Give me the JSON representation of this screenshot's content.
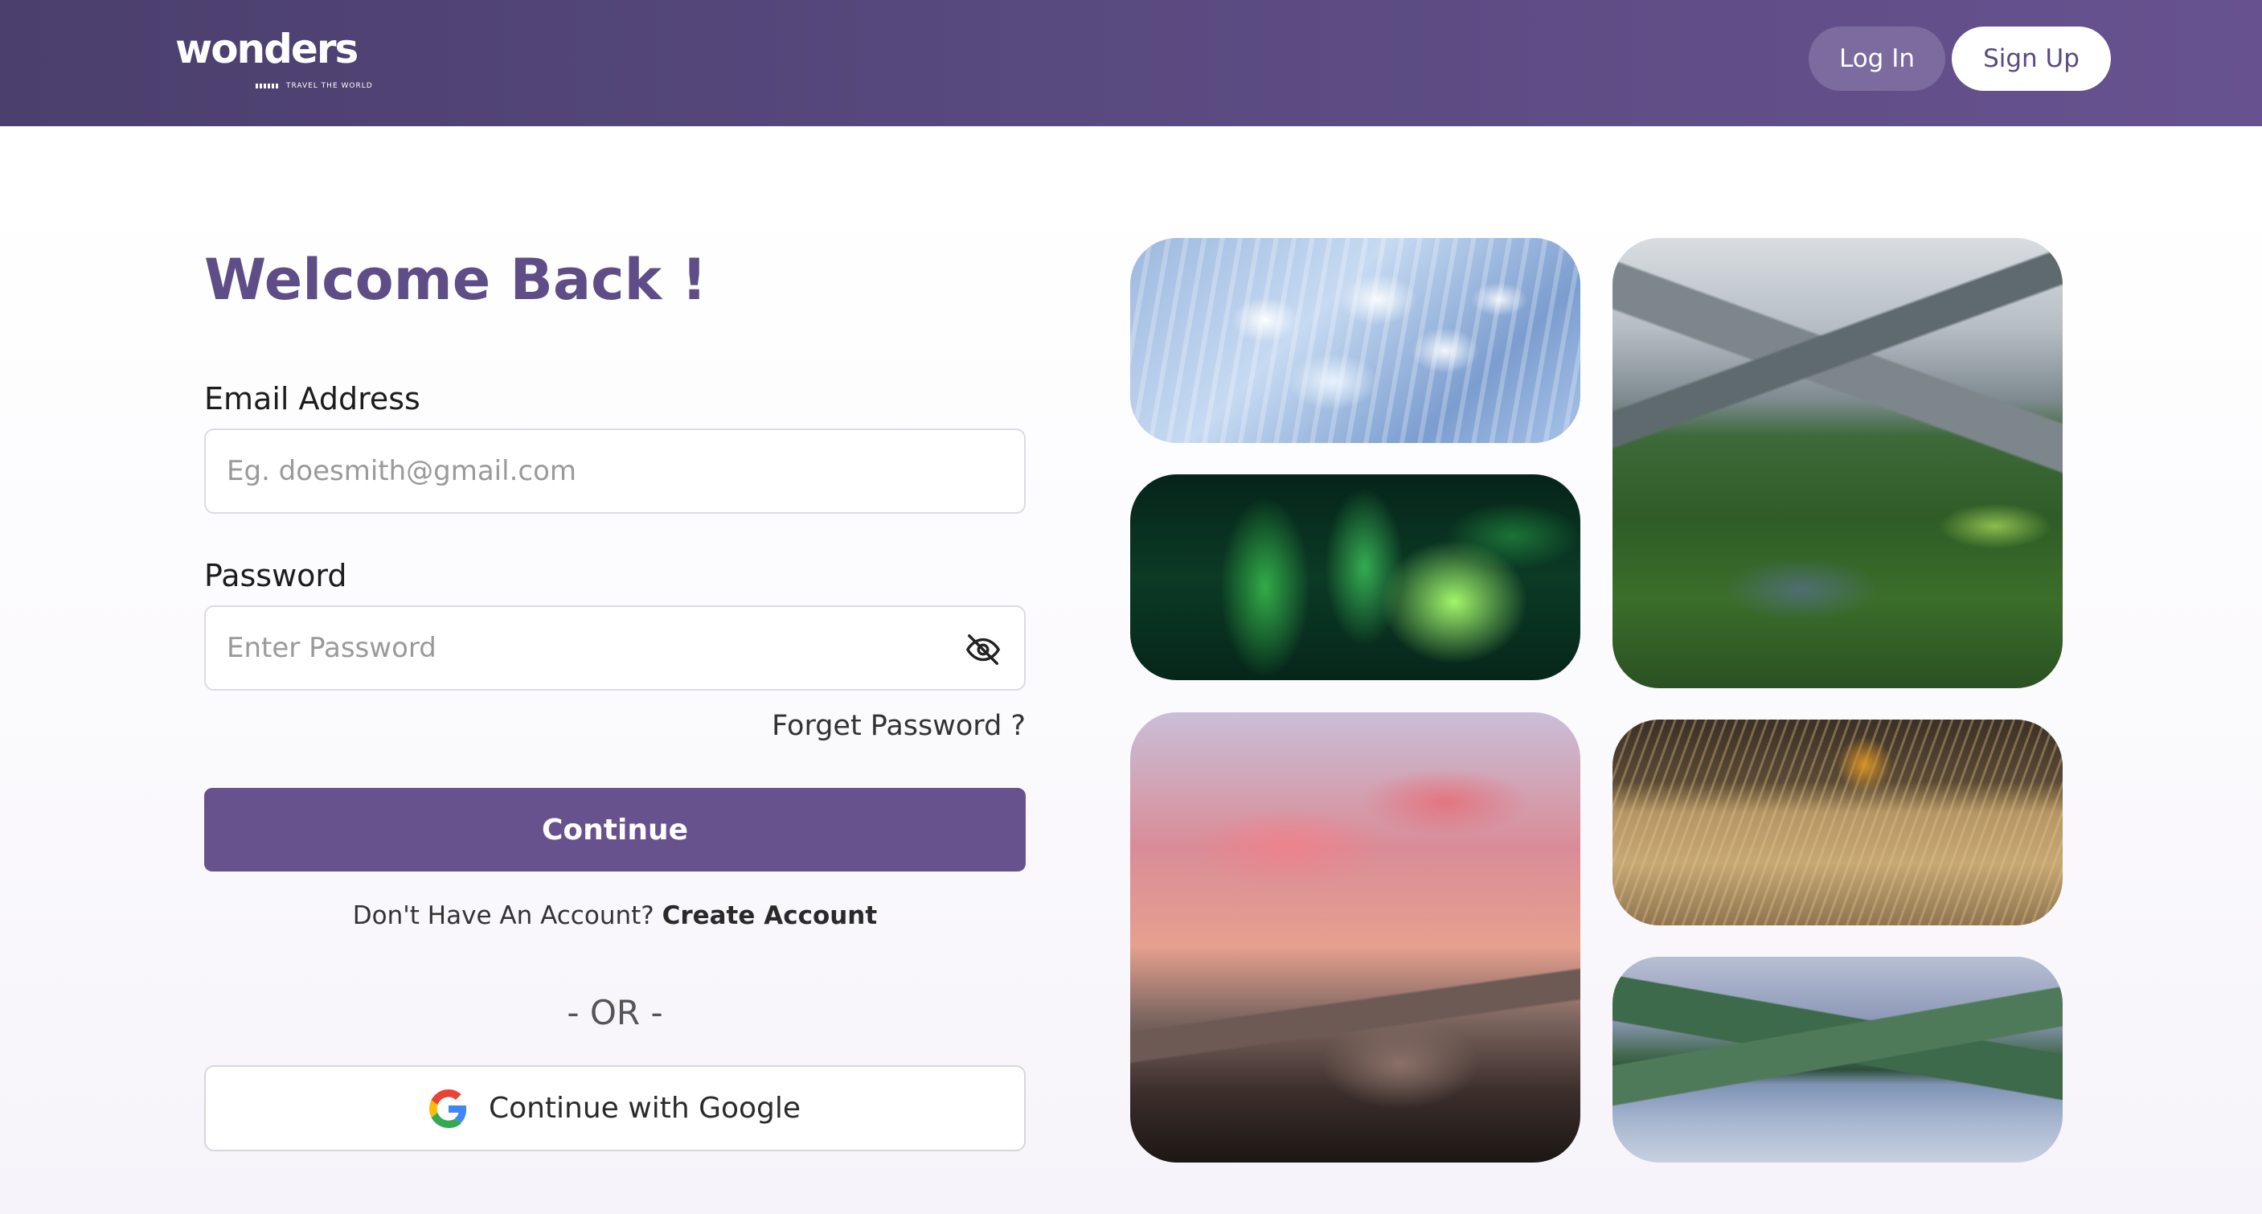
{
  "header": {
    "logo": {
      "wordmark": "wonders",
      "tagline": "TRAVEL THE WORLD"
    },
    "login_label": "Log In",
    "signup_label": "Sign Up"
  },
  "form": {
    "title": "Welcome Back !",
    "email_label": "Email Address",
    "email_placeholder": "Eg. doesmith@gmail.com",
    "password_label": "Password",
    "password_placeholder": "Enter Password",
    "password_toggle_icon": "eye-off-icon",
    "forgot_label": "Forget Password ?",
    "continue_label": "Continue",
    "no_account_text": "Don't Have An Account?",
    "create_account_label": "Create Account",
    "or_text": "- OR -",
    "google_label": "Continue with Google",
    "google_icon": "google-icon"
  },
  "gallery": {
    "tiles": [
      "ice-formation-photo",
      "aurora-borealis-photo",
      "alpine-valley-photo",
      "half-dome-sunset-photo",
      "autumn-grassland-photo",
      "mountain-lake-reflection-photo"
    ]
  },
  "colors": {
    "header_gradient_start": "#4b3f6d",
    "header_gradient_end": "#67528f",
    "primary": "#67528e",
    "title": "#5e4d86",
    "login_button_bg": "#7b6b9e"
  }
}
